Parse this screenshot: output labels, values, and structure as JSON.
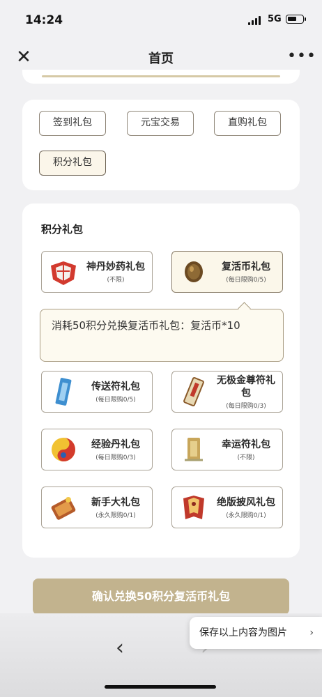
{
  "status_bar": {
    "time": "14:24",
    "network": "5G"
  },
  "nav": {
    "title": "首页",
    "close_icon": "close-icon",
    "more_icon": "more-icon"
  },
  "tabs": [
    {
      "label": "签到礼包"
    },
    {
      "label": "元宝交易"
    },
    {
      "label": "直购礼包"
    },
    {
      "label": "积分礼包",
      "active": true
    }
  ],
  "section_title": "积分礼包",
  "packs": [
    {
      "name": "神丹妙药礼包",
      "limit": "(不限)",
      "icon": "red-bundle-icon"
    },
    {
      "name": "复活币礼包",
      "limit": "(每日限购0/5)",
      "icon": "revive-coin-icon",
      "selected": true
    },
    {
      "name": "传送符礼包",
      "limit": "(每日限购0/5)",
      "icon": "teleport-talisman-icon"
    },
    {
      "name": "无极金尊符礼包",
      "limit": "(每日限购0/3)",
      "icon": "gold-talisman-icon"
    },
    {
      "name": "经验丹礼包",
      "limit": "(每日限购0/3)",
      "icon": "exp-pill-icon"
    },
    {
      "name": "幸运符礼包",
      "limit": "(不限)",
      "icon": "luck-talisman-icon"
    },
    {
      "name": "新手大礼包",
      "limit": "(永久限购0/1)",
      "icon": "newbie-pack-icon"
    },
    {
      "name": "绝版披风礼包",
      "limit": "(永久限购0/1)",
      "icon": "cape-icon"
    }
  ],
  "tooltip": {
    "text": "消耗50积分兑换复活币礼包：复活币*10"
  },
  "confirm_button": {
    "label": "确认兑换50积分复活币礼包"
  },
  "save_toast": {
    "label": "保存以上内容为图片"
  }
}
